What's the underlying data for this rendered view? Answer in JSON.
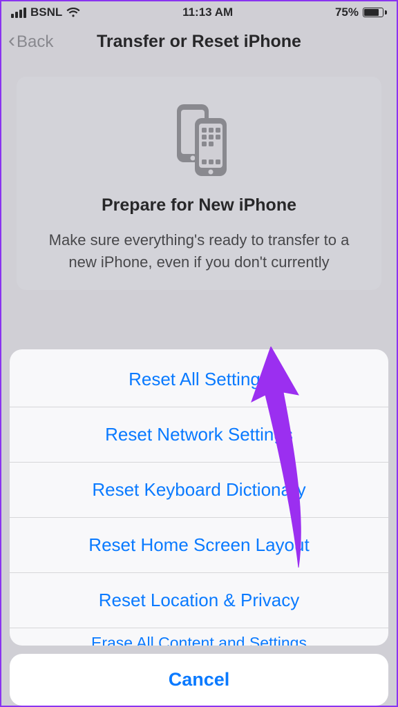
{
  "status": {
    "carrier": "BSNL",
    "time": "11:13 AM",
    "battery_percent": "75%"
  },
  "nav": {
    "back_label": "Back",
    "title": "Transfer or Reset iPhone"
  },
  "card": {
    "title": "Prepare for New iPhone",
    "body": "Make sure everything's ready to transfer to a new iPhone, even if you don't currently"
  },
  "sheet": {
    "items": [
      "Reset All Settings",
      "Reset Network Settings",
      "Reset Keyboard Dictionary",
      "Reset Home Screen Layout",
      "Reset Location & Privacy"
    ],
    "truncated_item": "Erase All Content and Settings",
    "cancel": "Cancel"
  }
}
